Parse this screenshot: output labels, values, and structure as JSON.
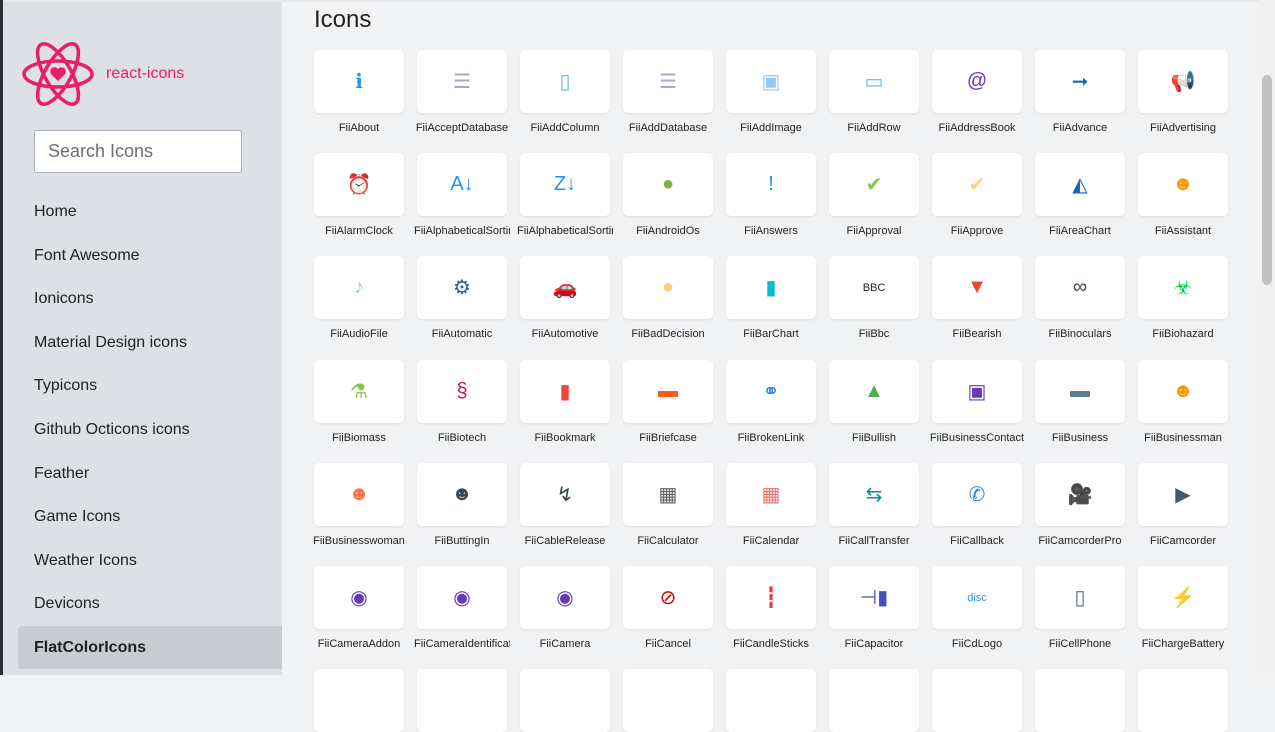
{
  "sidebar": {
    "brand": "react-icons",
    "search_placeholder": "Search Icons",
    "items": [
      {
        "label": "Home"
      },
      {
        "label": "Font Awesome"
      },
      {
        "label": "Ionicons"
      },
      {
        "label": "Material Design icons"
      },
      {
        "label": "Typicons"
      },
      {
        "label": "Github Octicons icons"
      },
      {
        "label": "Feather"
      },
      {
        "label": "Game Icons"
      },
      {
        "label": "Weather Icons"
      },
      {
        "label": "Devicons"
      },
      {
        "label": "FlatColorIcons",
        "active": true
      }
    ]
  },
  "main": {
    "title": "Icons",
    "icons": [
      {
        "label": "FiiAbout",
        "glyph": "ℹ",
        "color": "#2196f3"
      },
      {
        "label": "FiiAcceptDatabase",
        "glyph": "☰",
        "color": "#b39ddb"
      },
      {
        "label": "FiiAddColumn",
        "glyph": "▯",
        "color": "#64b5f6"
      },
      {
        "label": "FiiAddDatabase",
        "glyph": "☰",
        "color": "#b39ddb"
      },
      {
        "label": "FiiAddImage",
        "glyph": "▣",
        "color": "#90caf9"
      },
      {
        "label": "FiiAddRow",
        "glyph": "▭",
        "color": "#64b5f6"
      },
      {
        "label": "FiiAddressBook",
        "glyph": "@",
        "color": "#673ab7"
      },
      {
        "label": "FiiAdvance",
        "glyph": "➞",
        "color": "#1565c0"
      },
      {
        "label": "FiiAdvertising",
        "glyph": "📢",
        "color": "#3f51b5"
      },
      {
        "label": "FiiAlarmClock",
        "glyph": "⏰",
        "color": "#c62828"
      },
      {
        "label": "FiiAlphabeticalSorting",
        "glyph": "A↓",
        "color": "#2196f3"
      },
      {
        "label": "FiiAlphabeticalSorting",
        "glyph": "Z↓",
        "color": "#2196f3"
      },
      {
        "label": "FiiAndroidOs",
        "glyph": "●",
        "color": "#7cb342"
      },
      {
        "label": "FiiAnswers",
        "glyph": "!",
        "color": "#2196f3"
      },
      {
        "label": "FiiApproval",
        "glyph": "✔",
        "color": "#8bc34a"
      },
      {
        "label": "FiiApprove",
        "glyph": "✔",
        "color": "#ffcc80"
      },
      {
        "label": "FiiAreaChart",
        "glyph": "◭",
        "color": "#1565c0"
      },
      {
        "label": "FiiAssistant",
        "glyph": "☻",
        "color": "#ff9800"
      },
      {
        "label": "FiiAudioFile",
        "glyph": "♪",
        "color": "#90caf9"
      },
      {
        "label": "FiiAutomatic",
        "glyph": "⚙",
        "color": "#3f51b5"
      },
      {
        "label": "FiiAutomotive",
        "glyph": "🚗",
        "color": "#e53935"
      },
      {
        "label": "FiiBadDecision",
        "glyph": "●",
        "color": "#ffcc80"
      },
      {
        "label": "FiiBarChart",
        "glyph": "▮",
        "color": "#00bcd4"
      },
      {
        "label": "FiiBbc",
        "glyph": "BBC",
        "color": "#222222"
      },
      {
        "label": "FiiBearish",
        "glyph": "▼",
        "color": "#f44336"
      },
      {
        "label": "FiiBinoculars",
        "glyph": "∞",
        "color": "#37474f"
      },
      {
        "label": "FiiBiohazard",
        "glyph": "☣",
        "color": "#00c853"
      },
      {
        "label": "FiiBiomass",
        "glyph": "⚗",
        "color": "#8bc34a"
      },
      {
        "label": "FiiBiotech",
        "glyph": "§",
        "color": "#c2185b"
      },
      {
        "label": "FiiBookmark",
        "glyph": "▮",
        "color": "#f44336"
      },
      {
        "label": "FiiBriefcase",
        "glyph": "▬",
        "color": "#ff5722"
      },
      {
        "label": "FiiBrokenLink",
        "glyph": "⚭",
        "color": "#1e88e5"
      },
      {
        "label": "FiiBullish",
        "glyph": "▲",
        "color": "#4caf50"
      },
      {
        "label": "FiiBusinessContact",
        "glyph": "▣",
        "color": "#673ab7"
      },
      {
        "label": "FiiBusiness",
        "glyph": "▬",
        "color": "#607d8b"
      },
      {
        "label": "FiiBusinessman",
        "glyph": "☻",
        "color": "#ff9800"
      },
      {
        "label": "FiiBusinesswoman",
        "glyph": "☻",
        "color": "#ff7043"
      },
      {
        "label": "FiiButtingIn",
        "glyph": "☻",
        "color": "#37474f"
      },
      {
        "label": "FiiCableRelease",
        "glyph": "↯",
        "color": "#37474f"
      },
      {
        "label": "FiiCalculator",
        "glyph": "▦",
        "color": "#616161"
      },
      {
        "label": "FiiCalendar",
        "glyph": "▦",
        "color": "#e57373"
      },
      {
        "label": "FiiCallTransfer",
        "glyph": "⇆",
        "color": "#009688"
      },
      {
        "label": "FiiCallback",
        "glyph": "✆",
        "color": "#1e88e5"
      },
      {
        "label": "FiiCamcorderPro",
        "glyph": "🎥",
        "color": "#455a64"
      },
      {
        "label": "FiiCamcorder",
        "glyph": "▶",
        "color": "#455a64"
      },
      {
        "label": "FiiCameraAddon",
        "glyph": "◉",
        "color": "#673ab7"
      },
      {
        "label": "FiiCameraIdentification",
        "glyph": "◉",
        "color": "#673ab7"
      },
      {
        "label": "FiiCamera",
        "glyph": "◉",
        "color": "#673ab7"
      },
      {
        "label": "FiiCancel",
        "glyph": "⊘",
        "color": "#d50000"
      },
      {
        "label": "FiiCandleSticks",
        "glyph": "┇",
        "color": "#e53935"
      },
      {
        "label": "FiiCapacitor",
        "glyph": "⊣▮",
        "color": "#3f51b5"
      },
      {
        "label": "FiiCdLogo",
        "glyph": "disc",
        "color": "#2196f3"
      },
      {
        "label": "FiiCellPhone",
        "glyph": "▯",
        "color": "#546e7a"
      },
      {
        "label": "FiiChargeBattery",
        "glyph": "⚡",
        "color": "#8bc34a"
      }
    ]
  }
}
